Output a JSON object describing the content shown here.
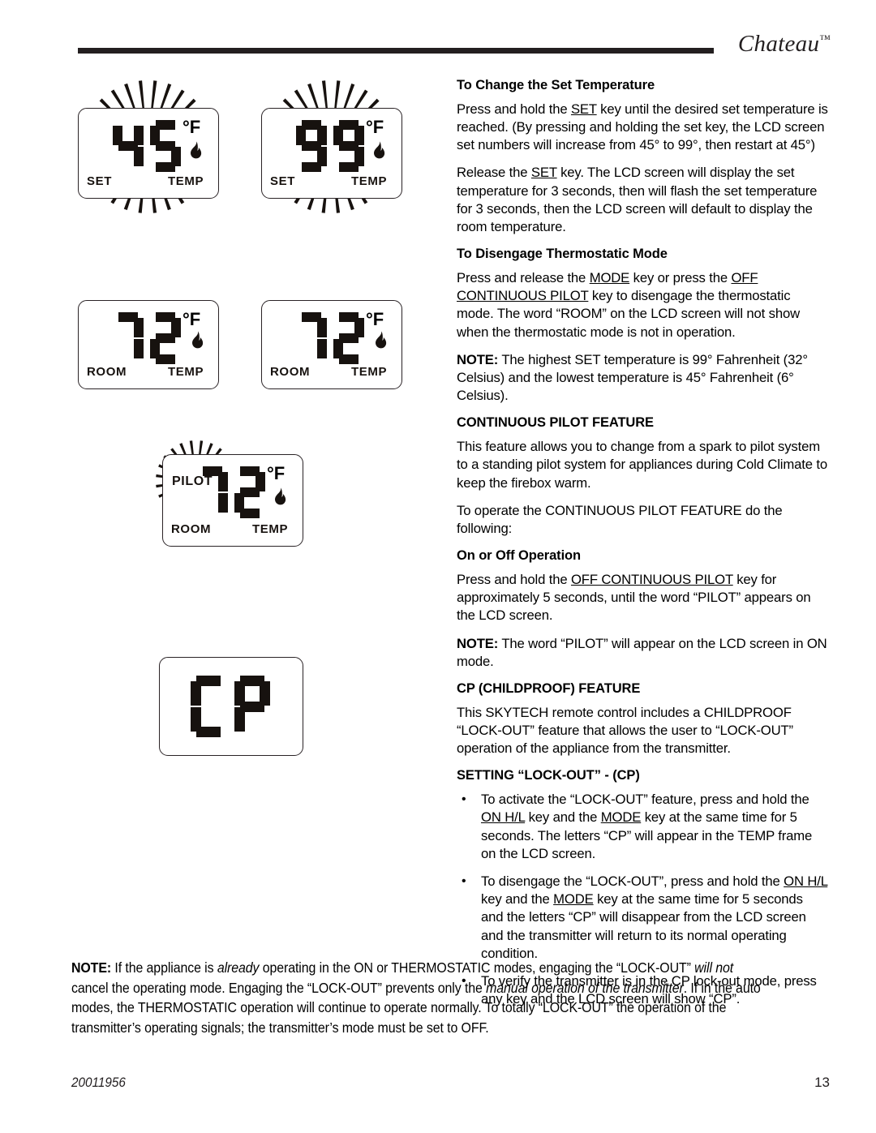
{
  "header": {
    "brand": "Chateau",
    "trademark": "™"
  },
  "displays": [
    {
      "name": "set-temp-45",
      "value": "45",
      "unit": "°F",
      "left_label": "SET",
      "right_label": "TEMP",
      "flashing": true,
      "flame": true,
      "flame_flashing": false,
      "pilot_label": ""
    },
    {
      "name": "set-temp-99",
      "value": "99",
      "unit": "°F",
      "left_label": "SET",
      "right_label": "TEMP",
      "flashing": true,
      "flame": true,
      "flame_flashing": false,
      "pilot_label": ""
    },
    {
      "name": "room-temp-72",
      "value": "72",
      "unit": "°F",
      "left_label": "ROOM",
      "right_label": "TEMP",
      "flashing": false,
      "flame": true,
      "flame_flashing": true,
      "pilot_label": ""
    },
    {
      "name": "room-temp-72-flashing-flame",
      "value": "72",
      "unit": "°F",
      "left_label": "ROOM",
      "right_label": "TEMP",
      "flashing": false,
      "flame": true,
      "flame_flashing": true,
      "pilot_label": ""
    },
    {
      "name": "pilot-room-temp-72",
      "value": "72",
      "unit": "°F",
      "left_label": "ROOM",
      "right_label": "TEMP",
      "flashing": false,
      "flame": true,
      "flame_flashing": false,
      "pilot_label": "PILOT"
    },
    {
      "name": "childproof-cp",
      "value": "CP",
      "unit": "",
      "left_label": "",
      "right_label": "",
      "flashing": false,
      "flame": false,
      "flame_flashing": false,
      "pilot_label": ""
    }
  ],
  "sections": {
    "set_temperature": {
      "heading": "To Change the Set Temperature",
      "p1_a": "Press and hold the ",
      "p1_key": "SET",
      "p1_b": " key until the desired set temperature is reached. (By pressing and holding the set key, the LCD screen set numbers will increase from 45° to 99°, then restart at 45°)",
      "p2_a": "Release the ",
      "p2_key": "SET",
      "p2_b": " key. The LCD screen will display the set temperature for 3 seconds, then will flash the set temperature for 3 seconds, then the LCD screen will default to display the room temperature."
    },
    "disengage_thermostatic": {
      "heading": "To Disengage Thermostatic Mode",
      "p1_a": "Press and release the ",
      "p1_key1": "MODE",
      "p1_b": " key or press the ",
      "p1_key2": "OFF CONTINUOUS PILOT",
      "p1_c": " key to disengage the thermostatic mode. The word “ROOM” on the LCD screen will not show when the thermostatic mode is not in operation.",
      "note_label": "NOTE:",
      "note_text": " The highest SET temperature is 99° Fahrenheit (32° Celsius) and the lowest temperature is 45° Fahrenheit (6° Celsius)."
    },
    "continuous_pilot": {
      "heading": "CONTINUOUS PILOT FEATURE",
      "p1": "This feature allows you to change from a spark to pilot system to a standing pilot system for appliances during Cold Climate to keep the firebox warm.",
      "p2": "To operate the CONTINUOUS PILOT FEATURE do the following:",
      "sub_heading": "On or Off Operation",
      "p3_a": "Press and hold the ",
      "p3_key": "OFF CONTINUOUS PILOT",
      "p3_b": " key for approximately 5 seconds, until the word “PILOT” appears on the LCD screen.",
      "note_label": "NOTE:",
      "note_text": " The word “PILOT” will appear on the LCD screen in ON mode."
    },
    "childproof": {
      "heading": "CP (CHILDPROOF) FEATURE",
      "p1": "This SKYTECH remote control includes a CHILDPROOF “LOCK-OUT” feature that allows the user to “LOCK-OUT” operation of the appliance from the transmitter.",
      "sub_heading": "SETTING “LOCK-OUT” - (CP)",
      "bullets": [
        {
          "a": "To activate the “LOCK-OUT” feature, press and hold the ",
          "key1": "ON H/L",
          "b": " key and the ",
          "key2": "MODE",
          "c": " key at the same time for 5 seconds. The letters “CP” will appear in the TEMP frame on the LCD screen."
        },
        {
          "a": "To disengage the “LOCK-OUT”, press and hold the ",
          "key1": "ON H/L",
          "b": " key and the ",
          "key2": "MODE",
          "c": " key at the same time for 5 seconds and the letters “CP” will disappear from the LCD screen and the transmitter will return to its normal operating condition."
        },
        {
          "a": "To verify the transmitter is in the CP lock-out mode, press any key and the LCD screen will show “CP”.",
          "key1": "",
          "b": "",
          "key2": "",
          "c": ""
        }
      ]
    },
    "bottom_note": {
      "label": "NOTE:",
      "t1": " If the appliance is ",
      "i1": "already",
      "t2": " operating in the ON or THERMOSTATIC modes, engaging the “LOCK-OUT” ",
      "i2": "will not",
      "t3": " cancel the operating mode. Engaging the “LOCK-OUT” prevents only the ",
      "i3": "manual operation of the transmitter",
      "t4": ". If in the auto modes, the THERMOSTATIC operation will continue to operate normally. To totally “LOCK-OUT” the operation of the transmitter’s operating signals; the transmitter’s mode must be set to OFF."
    }
  },
  "footer": {
    "document_number": "20011956",
    "page_number": "13"
  }
}
